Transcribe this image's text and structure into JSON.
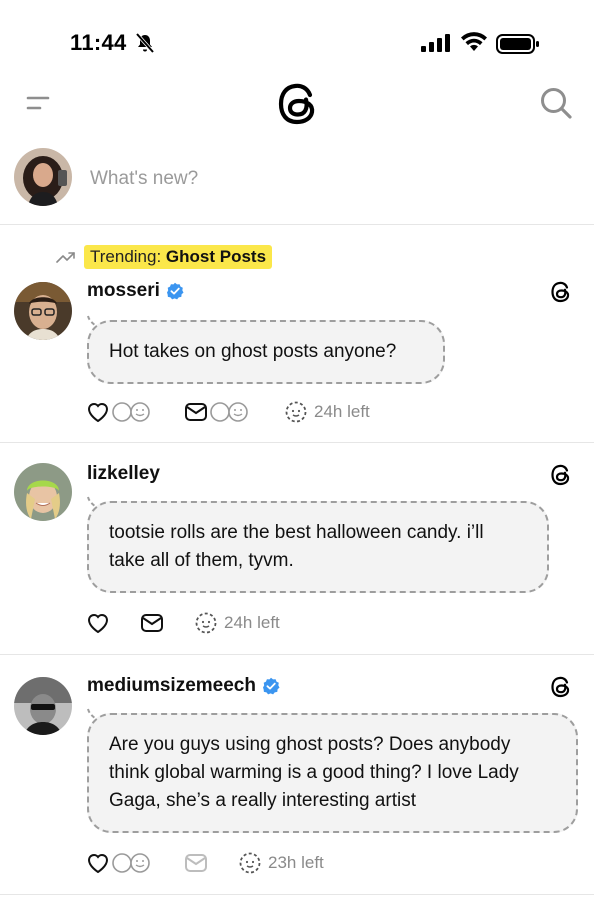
{
  "status_bar": {
    "time": "11:44"
  },
  "composer": {
    "placeholder": "What's new?"
  },
  "trending": {
    "prefix": "Trending:",
    "topic": "Ghost Posts"
  },
  "posts": [
    {
      "username": "mosseri",
      "verified": true,
      "text_lines": [
        "Hot takes on ghost posts anyone?"
      ],
      "time_left": "24h left",
      "show_reply_avatars": true
    },
    {
      "username": "lizkelley",
      "verified": false,
      "text_lines": [
        "tootsie rolls are the best halloween candy. i’ll",
        "take all of them, tyvm."
      ],
      "time_left": "24h left",
      "show_reply_avatars": false
    },
    {
      "username": "mediumsizemeech",
      "verified": true,
      "text_lines": [
        "Are you guys using ghost posts? Does anybody",
        "think global warming is a good thing? I love Lady",
        "Gaga, she’s a really interesting artist"
      ],
      "time_left": "23h left",
      "show_reply_avatars": true
    }
  ],
  "colors": {
    "highlight": "#fbe74a",
    "verified": "#3b95f0",
    "muted": "#8a8a8a",
    "bubble_bg": "#f3f3f3",
    "bubble_border": "#9e9e9e"
  },
  "icons": [
    "bell-slash-icon",
    "signal-icon",
    "wifi-icon",
    "battery-icon",
    "menu-icon",
    "threads-logo",
    "search-icon",
    "trending-arrow-icon",
    "verified-badge-icon",
    "heart-icon",
    "reply-faces-icon",
    "message-icon",
    "ghost-timer-icon"
  ]
}
